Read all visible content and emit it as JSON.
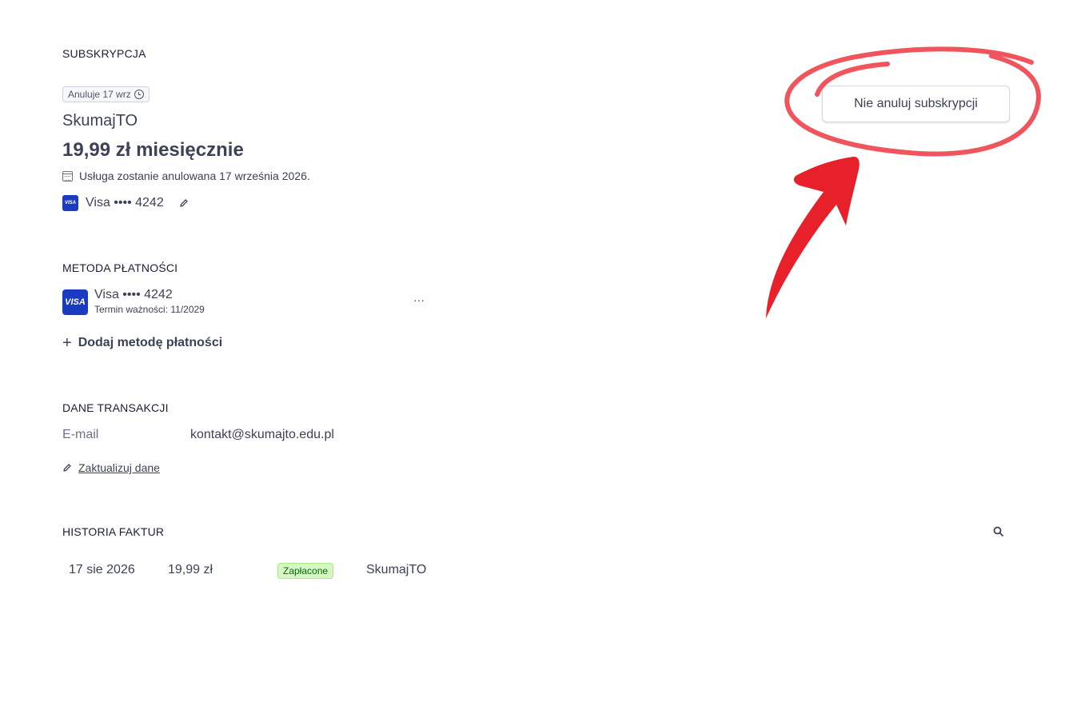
{
  "subscription": {
    "section_title": "SUBSKRYPCJA",
    "cancel_badge": "Anuluje 17 wrz",
    "product_name": "SkumajTO",
    "price": "19,99 zł miesięcznie",
    "cancel_info": "Usługa zostanie anulowana 17 września 2026.",
    "card_label": "Visa •••• 4242",
    "dont_cancel_button": "Nie anuluj subskrypcji"
  },
  "payment_method": {
    "section_title": "METODA PŁATNOŚCI",
    "card_brand": "VISA",
    "card_label": "Visa •••• 4242",
    "expiry": "Termin ważności: 11/2029",
    "more": "···",
    "add_label": "Dodaj metodę płatności"
  },
  "billing": {
    "section_title": "DANE TRANSAKCJI",
    "email_label": "E-mail",
    "email_value": "kontakt@skumajto.edu.pl",
    "update_label": "Zaktualizuj dane"
  },
  "invoices": {
    "section_title": "HISTORIA FAKTUR",
    "rows": [
      {
        "date": "17 sie 2026",
        "amount": "19,99 zł",
        "status": "Zapłacone",
        "product": "SkumajTO"
      }
    ]
  },
  "colors": {
    "annotation_red": "#e8202a",
    "annotation_circle": "#f0545c",
    "visa_blue": "#1a3bbf",
    "paid_bg": "#d7f7c2"
  }
}
